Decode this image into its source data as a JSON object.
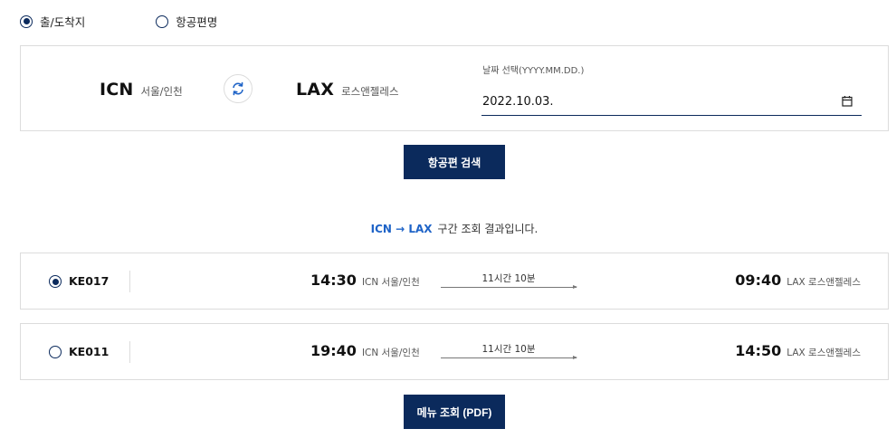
{
  "trip_type": {
    "options": [
      {
        "label": "출/도착지",
        "checked": true
      },
      {
        "label": "항공편명",
        "checked": false
      }
    ]
  },
  "search": {
    "origin": {
      "code": "ICN",
      "city": "서울/인천"
    },
    "destination": {
      "code": "LAX",
      "city": "로스앤젤레스"
    },
    "swap_icon": "swap-arrows-icon",
    "date_label": "날짜 선택(YYYY.MM.DD.)",
    "date_value": "2022.10.03.",
    "calendar_icon": "calendar-icon",
    "search_button": "항공편 검색"
  },
  "results": {
    "route": "ICN → LAX",
    "caption": "구간 조회 결과입니다.",
    "flights": [
      {
        "number": "KE017",
        "selected": true,
        "dep_time": "14:30",
        "dep_airport": "ICN 서울/인천",
        "duration": "11시간 10분",
        "arr_time": "09:40",
        "arr_airport": "LAX 로스앤젤레스"
      },
      {
        "number": "KE011",
        "selected": false,
        "dep_time": "19:40",
        "dep_airport": "ICN 서울/인천",
        "duration": "11시간 10분",
        "arr_time": "14:50",
        "arr_airport": "LAX 로스앤젤레스"
      }
    ]
  },
  "menu_button": "메뉴 조회 (PDF)",
  "colors": {
    "primary": "#0b2a5c",
    "route_highlight": "#1e63c7",
    "border": "#dcdcdc"
  }
}
